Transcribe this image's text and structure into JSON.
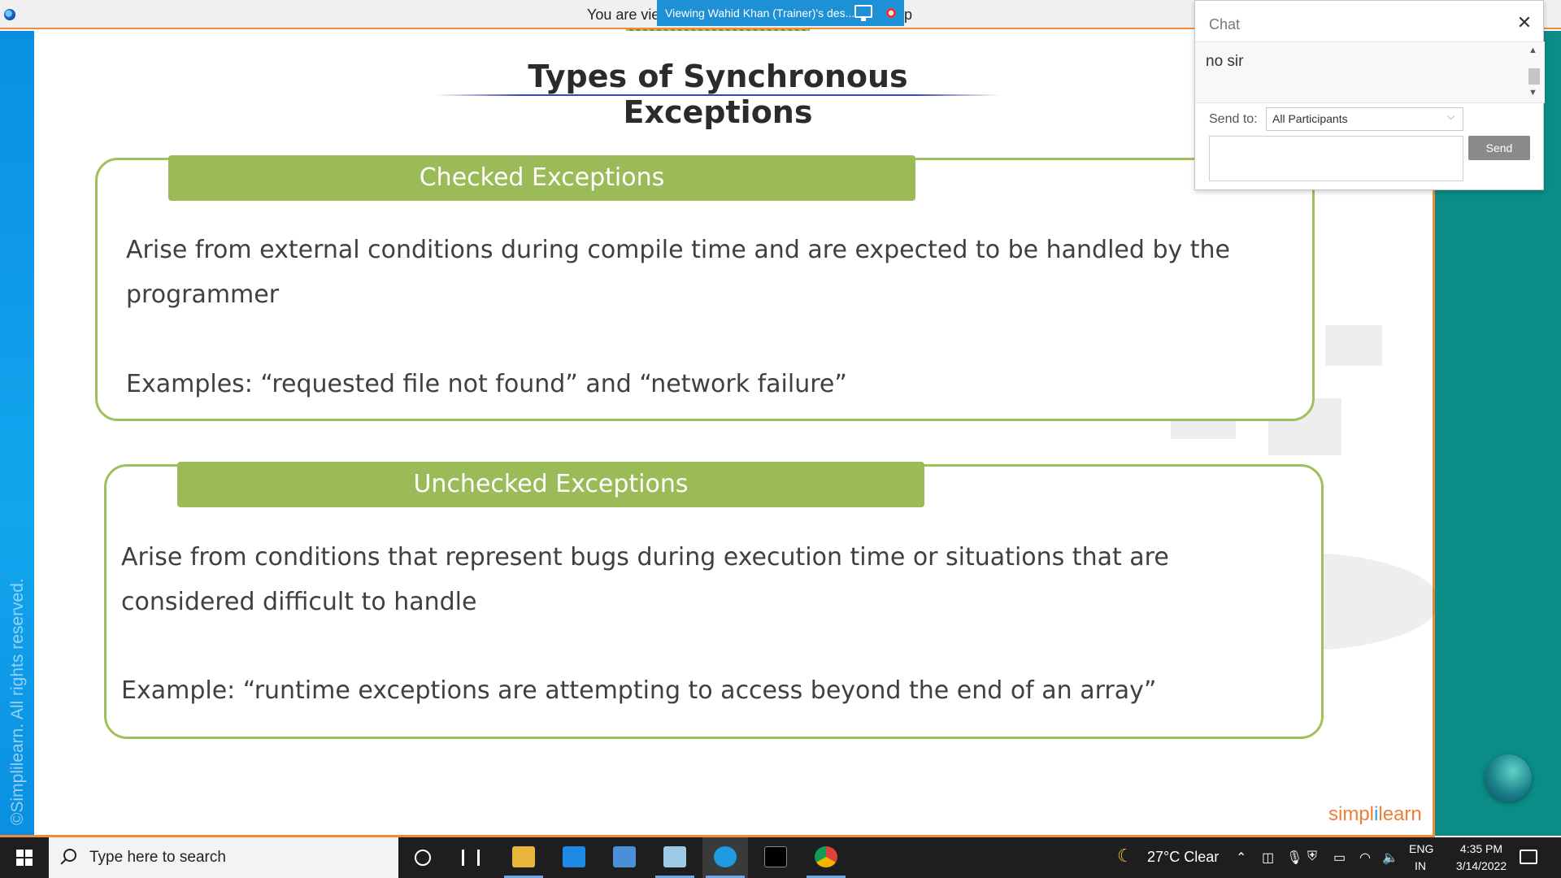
{
  "viewer_bar": {
    "left_text": "You are vie",
    "banner_text": "Viewing Wahid Khan (Trainer)'s des...",
    "trailing_char": "p"
  },
  "slide": {
    "title": "Types of Synchronous Exceptions",
    "copyright": "©Simplilearn. All rights reserved.",
    "brand_left": "simpl",
    "brand_mark": "i",
    "brand_right": "learn",
    "sections": [
      {
        "header": "Checked Exceptions",
        "description": "Arise from external conditions during compile time and are expected to be handled by the programmer",
        "example": "Examples: “requested file not found” and “network failure”"
      },
      {
        "header": "Unchecked Exceptions",
        "description": "Arise from conditions that represent bugs during execution time or situations that are considered difficult to handle",
        "example": "Example: “runtime exceptions are attempting to access beyond the end of an array”"
      }
    ],
    "colors": {
      "header_green": "#9bbb59",
      "border_green": "#9fc05a",
      "left_strip_blue": "#12a6ee",
      "right_strip_teal": "#0b8c86",
      "accent_orange": "#f08a3c"
    }
  },
  "chat": {
    "title": "Chat",
    "close_icon": "close-icon",
    "message": "no sir",
    "send_to_label": "Send to:",
    "send_to_value": "All Participants",
    "send_label": "Send",
    "input_value": ""
  },
  "taskbar": {
    "search_placeholder": "Type here to search",
    "apps": [
      "file-explorer",
      "mail",
      "remote-desktop",
      "notes",
      "zoom-meeting",
      "terminal",
      "chrome"
    ],
    "weather": "27°C  Clear",
    "language_top": "ENG",
    "language_bottom": "IN",
    "time": "4:35 PM",
    "date": "3/14/2022"
  }
}
